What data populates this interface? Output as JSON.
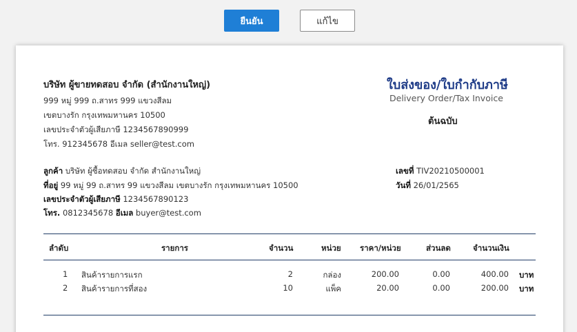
{
  "buttons": {
    "confirm": "ยืนยัน",
    "edit": "แก้ไข"
  },
  "seller": {
    "name": "บริษัท ผู้ขายทดสอบ จำกัด (สำนักงานใหญ่)",
    "address1": "999 หมู่ 999 ถ.สาทร 999 แขวงสีลม",
    "address2": "เขตบางรัก  กรุงเทพมหานคร 10500",
    "tax_id": "เลขประจำตัวผู้เสียภาษี 1234567890999",
    "contact": "โทร. 912345678  อีเมล seller@test.com"
  },
  "document": {
    "title_th": "ใบส่งของ/ใบกำกับภาษี",
    "title_en": "Delivery Order/Tax Invoice",
    "copy": "ต้นฉบับ",
    "number_label": "เลขที่",
    "number": "TIV20210500001",
    "date_label": "วันที่",
    "date": "26/01/2565"
  },
  "buyer": {
    "name_label": "ลูกค้า",
    "name": "บริษัท ผู้ซื้อทดสอบ จำกัด  สำนักงานใหญ่",
    "address_label": "ที่อยู่",
    "address": "99 หมู่ 99  ถ.สาทร 99 แขวงสีลม เขตบางรัก กรุงเทพมหานคร 10500",
    "tax_label": "เลขประจำตัวผู้เสียภาษี",
    "tax_id": "1234567890123",
    "phone_label": "โทร.",
    "phone": "0812345678",
    "email_label": "อีเมล",
    "email": "buyer@test.com"
  },
  "table": {
    "headers": [
      "ลำดับ",
      "รายการ",
      "จำนวน",
      "หน่วย",
      "ราคา/หน่วย",
      "ส่วนลด",
      "จำนวนเงิน"
    ],
    "currency": "บาท",
    "rows": [
      {
        "no": "1",
        "item": "สินค้ารายการแรก",
        "qty": "2",
        "unit": "กล่อง",
        "price": "200.00",
        "discount": "0.00",
        "amount": "400.00"
      },
      {
        "no": "2",
        "item": "สินค้ารายการที่สอง",
        "qty": "10",
        "unit": "แพ็ค",
        "price": "20.00",
        "discount": "0.00",
        "amount": "200.00"
      }
    ]
  }
}
